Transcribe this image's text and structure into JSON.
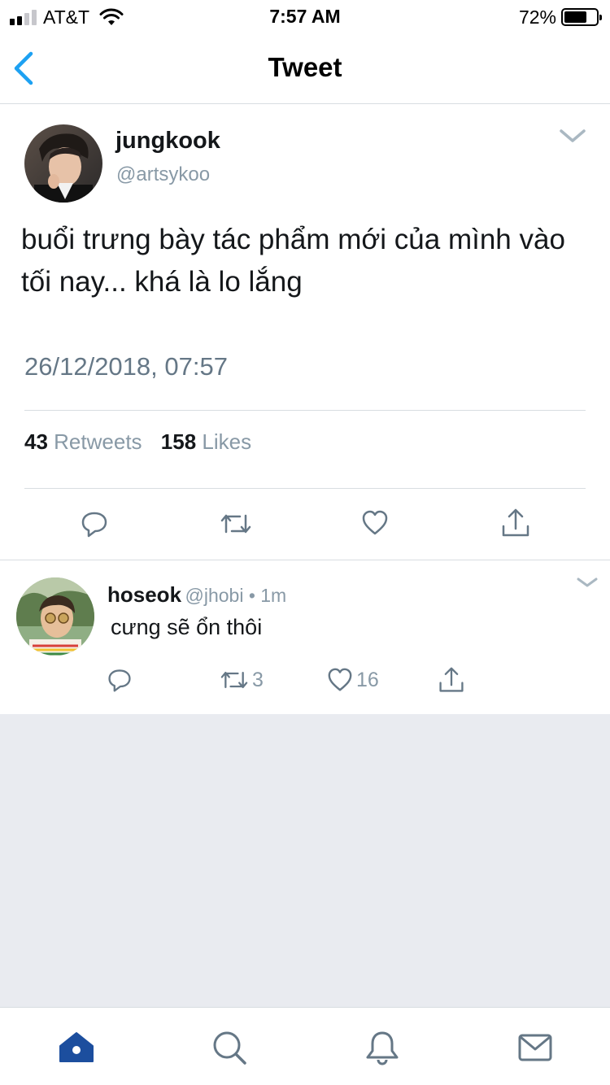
{
  "status_bar": {
    "carrier": "AT&T",
    "time": "7:57 AM",
    "battery_percent": "72%",
    "battery_level": 0.72,
    "signal_bars": 4,
    "signal_bars_filled": 2
  },
  "nav": {
    "title": "Tweet",
    "back_icon": "chevron-left-icon"
  },
  "main_tweet": {
    "display_name": "jungkook",
    "handle": "@artsykoo",
    "text": "buổi trưng bày tác phẩm mới của mình vào tối nay... khá là lo lắng",
    "timestamp": "26/12/2018, 07:57",
    "retweets_count": "43",
    "retweets_label": "Retweets",
    "likes_count": "158",
    "likes_label": "Likes",
    "actions": [
      "reply-icon",
      "retweet-icon",
      "heart-icon",
      "share-icon"
    ]
  },
  "reply": {
    "display_name": "hoseok",
    "meta": "@jhobi • 1m",
    "text": "cưng sẽ ổn thôi",
    "retweet_count": "3",
    "like_count": "16"
  },
  "tab_bar": {
    "tabs": [
      "home-icon",
      "search-icon",
      "notifications-icon",
      "messages-icon"
    ],
    "active": "home-icon"
  },
  "colors": {
    "accent": "#1da1f2",
    "icon_gray": "#657786",
    "meta_gray": "#8899a6",
    "divider": "#d8dde1",
    "empty_bg": "#e9ebf0",
    "home_active": "#1c4e9e"
  }
}
